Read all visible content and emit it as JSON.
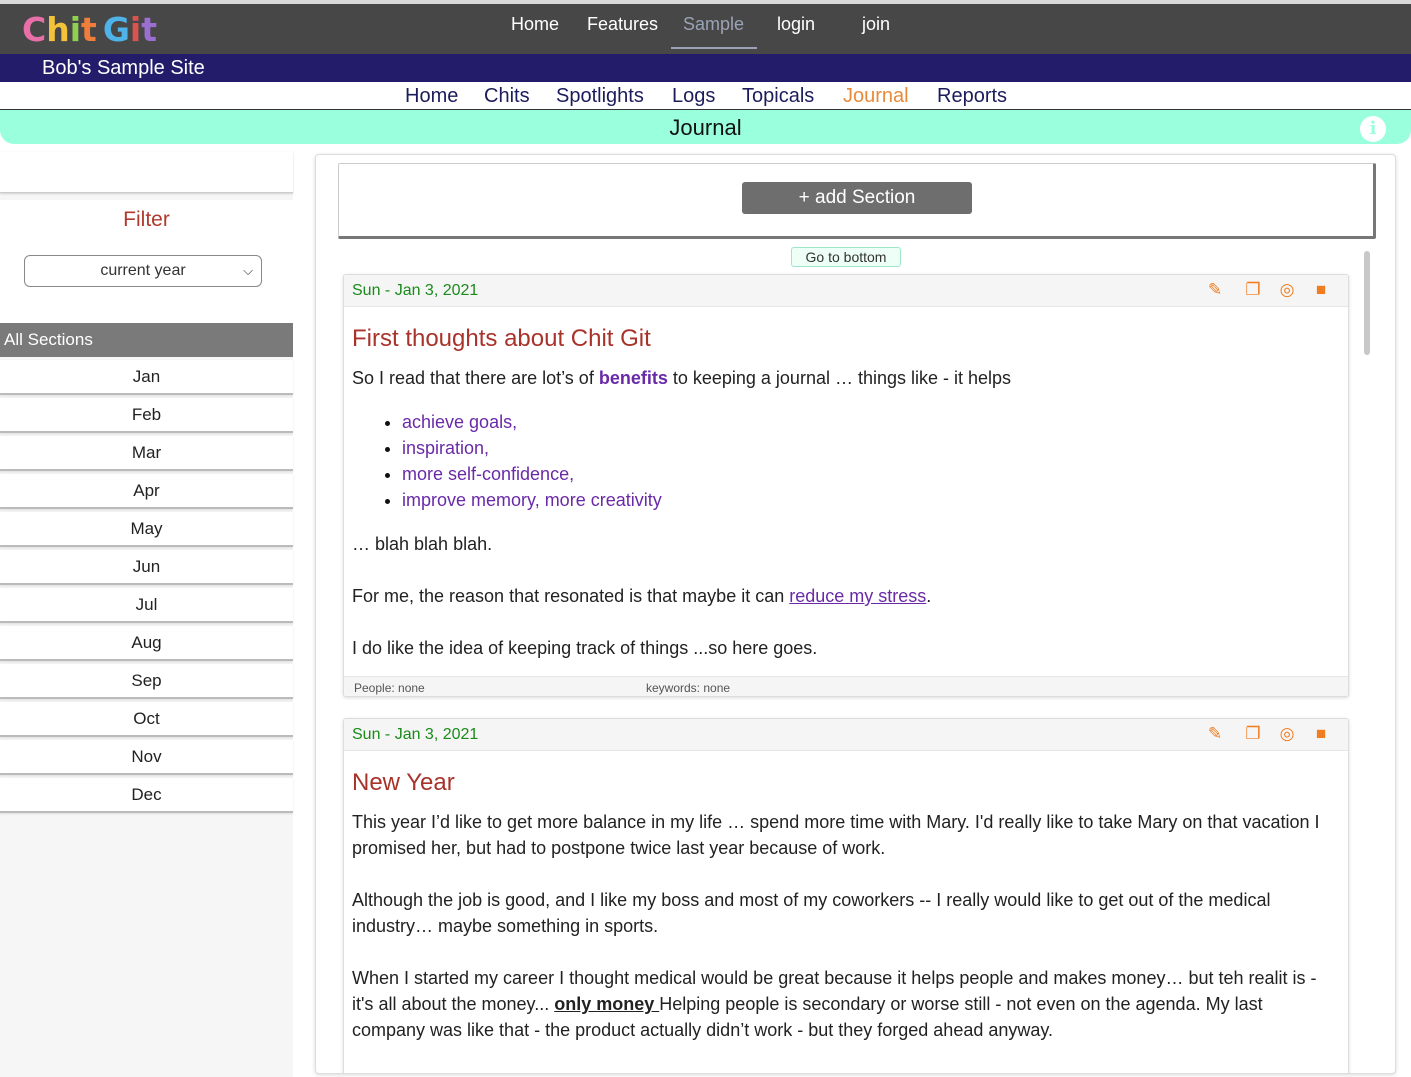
{
  "brand": {
    "logo_letters": [
      {
        "ch": "C",
        "color": "#e86fa8"
      },
      {
        "ch": "h",
        "color": "#f2c23a"
      },
      {
        "ch": "i",
        "color": "#8fd14f"
      },
      {
        "ch": "t",
        "color": "#f07d3a"
      },
      {
        "ch": " ",
        "color": "#ffffff"
      },
      {
        "ch": "G",
        "color": "#4fb3e8"
      },
      {
        "ch": "i",
        "color": "#d9534f"
      },
      {
        "ch": "t",
        "color": "#9b6fd1"
      }
    ]
  },
  "top_nav": {
    "items": [
      "Home",
      "Features",
      "Sample",
      "login",
      "join"
    ],
    "active": "Sample"
  },
  "site": {
    "name": "Bob's Sample Site"
  },
  "section_nav": {
    "items": [
      "Home",
      "Chits",
      "Spotlights",
      "Logs",
      "Topicals",
      "Journal",
      "Reports"
    ],
    "active": "Journal"
  },
  "page": {
    "title": "Journal",
    "info_icon": "info-icon"
  },
  "sidebar": {
    "filter_title": "Filter",
    "year_select": {
      "value": "current year"
    },
    "all_sections_label": "All Sections",
    "months": [
      "Jan",
      "Feb",
      "Mar",
      "Apr",
      "May",
      "Jun",
      "Jul",
      "Aug",
      "Sep",
      "Oct",
      "Nov",
      "Dec"
    ]
  },
  "main": {
    "add_section_label": "+ add Section",
    "go_to_bottom_label": "Go to bottom",
    "entries": [
      {
        "date": "Sun - Jan 3, 2021",
        "title": "First thoughts about Chit Git",
        "intro_before": "So I read that there are lot’s of ",
        "intro_bold": "benefits",
        "intro_after": " to keeping a journal … things like - it helps",
        "bullets": [
          "achieve goals,",
          "inspiration,",
          "more self-confidence,",
          "improve memory, more creativity"
        ],
        "p_blah": "… blah blah blah.",
        "p_reason_before": "For me, the reason that resonated is that maybe it can ",
        "p_reason_link": "reduce my stress",
        "p_reason_after": ".",
        "p_track": "I do like the idea of keeping track of things ...so here goes.",
        "people": "People: none",
        "keywords": "keywords: none"
      },
      {
        "date": "Sun - Jan 3, 2021",
        "title": "New Year",
        "p1": "This year I’d like to get more balance in my life … spend more time with Mary. I'd really like to take Mary on that vacation I promised her, but had to postpone twice last year because of work.",
        "p2": "Although the job is good, and I like my boss and most of my coworkers -- I really would like to get out of the medical industry… maybe something in sports.",
        "p3_before": "When I started my career I thought medical would be great because it helps people and makes money… but teh realit is - it's all about the money... ",
        "p3_bold": "only money ",
        "p3_after": " Helping people is secondary or worse still - not even on the agenda. My last company was like that - the product actually didn’t work - but they forged ahead anyway."
      }
    ],
    "tool_icons": [
      "pencil-icon",
      "copy-icon",
      "share-icon",
      "trash-icon"
    ]
  },
  "colors": {
    "topbar": "#474747",
    "sitebar": "#221c6b",
    "journal_header": "#99ffdd",
    "accent_orange": "#f07d20",
    "date_green": "#1a8a1a",
    "title_red": "#a8332b",
    "link_purple": "#6a2aa8"
  }
}
